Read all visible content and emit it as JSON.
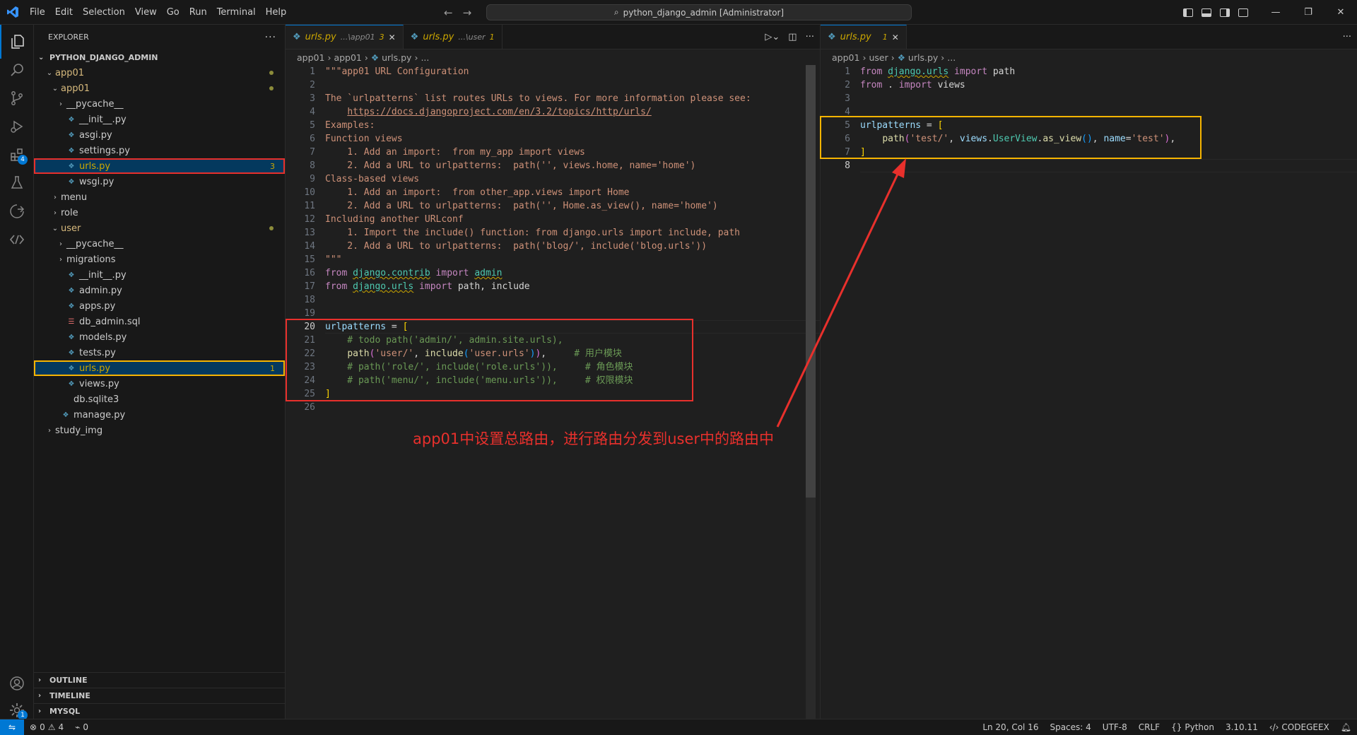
{
  "titlebar": {
    "menus": [
      "File",
      "Edit",
      "Selection",
      "View",
      "Go",
      "Run",
      "Terminal",
      "Help"
    ],
    "search_text": "python_django_admin [Administrator]"
  },
  "sidebar": {
    "title": "EXPLORER",
    "project": "PYTHON_DJANGO_ADMIN",
    "tree": [
      {
        "label": "app01",
        "kind": "folder",
        "open": true,
        "depth": 0,
        "color": "mod",
        "dot": true
      },
      {
        "label": "app01",
        "kind": "folder",
        "open": true,
        "depth": 1,
        "color": "mod",
        "dot": true
      },
      {
        "label": "__pycache__",
        "kind": "folder",
        "open": false,
        "depth": 2
      },
      {
        "label": "__init__.py",
        "kind": "py",
        "depth": 2
      },
      {
        "label": "asgi.py",
        "kind": "py",
        "depth": 2
      },
      {
        "label": "settings.py",
        "kind": "py",
        "depth": 2
      },
      {
        "label": "urls.py",
        "kind": "py",
        "depth": 2,
        "color": "warn",
        "count": "3",
        "box": "red"
      },
      {
        "label": "wsgi.py",
        "kind": "py",
        "depth": 2
      },
      {
        "label": "menu",
        "kind": "folder",
        "open": false,
        "depth": 1
      },
      {
        "label": "role",
        "kind": "folder",
        "open": false,
        "depth": 1
      },
      {
        "label": "user",
        "kind": "folder",
        "open": true,
        "depth": 1,
        "color": "mod",
        "dot": true
      },
      {
        "label": "__pycache__",
        "kind": "folder",
        "open": false,
        "depth": 2
      },
      {
        "label": "migrations",
        "kind": "folder",
        "open": false,
        "depth": 2
      },
      {
        "label": "__init__.py",
        "kind": "py",
        "depth": 2
      },
      {
        "label": "admin.py",
        "kind": "py",
        "depth": 2
      },
      {
        "label": "apps.py",
        "kind": "py",
        "depth": 2
      },
      {
        "label": "db_admin.sql",
        "kind": "sql",
        "depth": 2
      },
      {
        "label": "models.py",
        "kind": "py",
        "depth": 2
      },
      {
        "label": "tests.py",
        "kind": "py",
        "depth": 2
      },
      {
        "label": "urls.py",
        "kind": "py",
        "depth": 2,
        "color": "warn",
        "count": "1",
        "box": "yellow"
      },
      {
        "label": "views.py",
        "kind": "py",
        "depth": 2
      },
      {
        "label": "db.sqlite3",
        "kind": "sqlite",
        "depth": 1
      },
      {
        "label": "manage.py",
        "kind": "py",
        "depth": 1
      },
      {
        "label": "study_img",
        "kind": "folder",
        "open": false,
        "depth": 0
      }
    ],
    "sections": [
      "OUTLINE",
      "TIMELINE",
      "MYSQL"
    ]
  },
  "left_editor": {
    "tabs": [
      {
        "name": "urls.py",
        "desc": "...\\app01",
        "num": "3",
        "active": true
      },
      {
        "name": "urls.py",
        "desc": "...\\user",
        "num": "1",
        "active": false
      }
    ],
    "breadcrumbs": [
      "app01",
      "app01",
      "urls.py",
      "..."
    ],
    "lines": [
      [
        [
          "doc",
          "\"\"\"app01 URL Configuration"
        ]
      ],
      [],
      [
        [
          "doc",
          "The `urlpatterns` list routes URLs to views. For more information please see:"
        ]
      ],
      [
        [
          "doc",
          "    "
        ],
        [
          "doc u",
          "https://docs.djangoproject.com/en/3.2/topics/http/urls/"
        ]
      ],
      [
        [
          "doc",
          "Examples:"
        ]
      ],
      [
        [
          "doc",
          "Function views"
        ]
      ],
      [
        [
          "doc",
          "    1. Add an import:  from my_app import views"
        ]
      ],
      [
        [
          "doc",
          "    2. Add a URL to urlpatterns:  path('', views.home, name='home')"
        ]
      ],
      [
        [
          "doc",
          "Class-based views"
        ]
      ],
      [
        [
          "doc",
          "    1. Add an import:  from other_app.views import Home"
        ]
      ],
      [
        [
          "doc",
          "    2. Add a URL to urlpatterns:  path('', Home.as_view(), name='home')"
        ]
      ],
      [
        [
          "doc",
          "Including another URLconf"
        ]
      ],
      [
        [
          "doc",
          "    1. Import the include() function: from django.urls import include, path"
        ]
      ],
      [
        [
          "doc",
          "    2. Add a URL to urlpatterns:  path('blog/', include('blog.urls'))"
        ]
      ],
      [
        [
          "doc",
          "\"\"\""
        ]
      ],
      [
        [
          "k",
          "from "
        ],
        [
          "t squig",
          "django.contrib"
        ],
        [
          "k",
          " import "
        ],
        [
          "t squig",
          "admin"
        ]
      ],
      [
        [
          "k",
          "from "
        ],
        [
          "t squig",
          "django.urls"
        ],
        [
          "k",
          " import "
        ],
        [
          "p",
          "path, include"
        ]
      ],
      [],
      [],
      [
        [
          "v",
          "urlpatterns"
        ],
        [
          "p",
          " = "
        ],
        [
          "br",
          "["
        ]
      ],
      [
        [
          "c",
          "    # todo path('admin/', admin.site.urls),"
        ]
      ],
      [
        [
          "p",
          "    "
        ],
        [
          "f",
          "path"
        ],
        [
          "br2",
          "("
        ],
        [
          "s",
          "'user/'"
        ],
        [
          "p",
          ", "
        ],
        [
          "f",
          "include"
        ],
        [
          "br3",
          "("
        ],
        [
          "s",
          "'user.urls'"
        ],
        [
          "br3",
          ")"
        ],
        [
          "br2",
          ")"
        ],
        [
          "p",
          ",     "
        ],
        [
          "c",
          "# 用户模块"
        ]
      ],
      [
        [
          "c",
          "    # path('role/', include('role.urls')),     # 角色模块"
        ]
      ],
      [
        [
          "c",
          "    # path('menu/', include('menu.urls')),     # 权限模块"
        ]
      ],
      [
        [
          "br",
          "]"
        ]
      ],
      []
    ],
    "current_line": 20,
    "annotation": "app01中设置总路由，进行路由分发到user中的路由中"
  },
  "right_editor": {
    "tabs": [
      {
        "name": "urls.py",
        "desc": "",
        "num": "1",
        "active": true
      }
    ],
    "breadcrumbs": [
      "app01",
      "user",
      "urls.py",
      "..."
    ],
    "lines": [
      [
        [
          "k",
          "from "
        ],
        [
          "t squig",
          "django.urls"
        ],
        [
          "k",
          " import "
        ],
        [
          "p",
          "path"
        ]
      ],
      [
        [
          "k",
          "from "
        ],
        [
          "p",
          ". "
        ],
        [
          "k",
          "import "
        ],
        [
          "p",
          "views"
        ]
      ],
      [],
      [],
      [
        [
          "v",
          "urlpatterns"
        ],
        [
          "p",
          " = "
        ],
        [
          "br",
          "["
        ]
      ],
      [
        [
          "p",
          "    "
        ],
        [
          "f",
          "path"
        ],
        [
          "br2",
          "("
        ],
        [
          "s",
          "'test/'"
        ],
        [
          "p",
          ", "
        ],
        [
          "v",
          "views"
        ],
        [
          "p",
          "."
        ],
        [
          "t",
          "UserView"
        ],
        [
          "p",
          "."
        ],
        [
          "f",
          "as_view"
        ],
        [
          "br3",
          "()"
        ],
        [
          "p",
          ", "
        ],
        [
          "v",
          "name"
        ],
        [
          "p",
          "="
        ],
        [
          "s",
          "'test'"
        ],
        [
          "br2",
          ")"
        ],
        [
          "p",
          ","
        ]
      ],
      [
        [
          "br",
          "]"
        ]
      ],
      []
    ],
    "current_line": 8
  },
  "statusbar": {
    "errors": "0",
    "warnings": "4",
    "ports": "0",
    "position": "Ln 20, Col 16",
    "spaces": "Spaces: 4",
    "encoding": "UTF-8",
    "eol": "CRLF",
    "language": "Python",
    "version": "3.10.11",
    "ext": "CODEGEEX"
  },
  "icons": {
    "activity": [
      "explorer-icon",
      "search-icon",
      "source-control-icon",
      "run-debug-icon",
      "extensions-icon",
      "testing-icon",
      "remote-explorer-icon",
      "codegeex-icon",
      "account-icon",
      "settings-gear-icon"
    ]
  },
  "colors": {
    "accent": "#0078d4",
    "annotation_red": "#e8302c",
    "annotation_yellow": "#f6b400"
  }
}
